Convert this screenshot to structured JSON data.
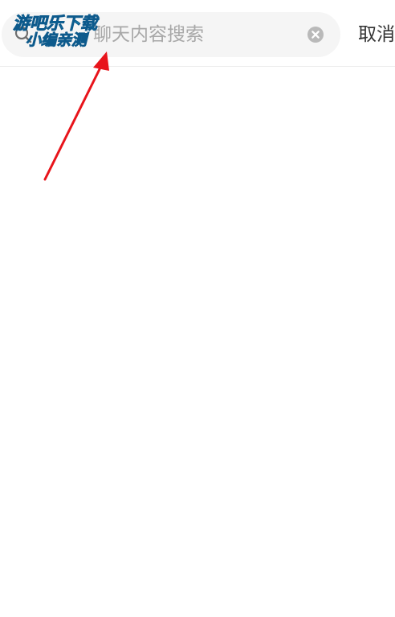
{
  "search": {
    "placeholder": "聊天内容搜索",
    "icon": "search-icon",
    "clear_icon": "clear-icon"
  },
  "header": {
    "cancel_label": "取消"
  },
  "watermark": {
    "line1": "游吧乐下载",
    "line2": "小编亲测"
  },
  "colors": {
    "annotation_arrow": "#e8141b",
    "watermark_fill": "#1fd0f0",
    "search_bg": "#f5f5f5",
    "placeholder": "#a8a8a8"
  }
}
